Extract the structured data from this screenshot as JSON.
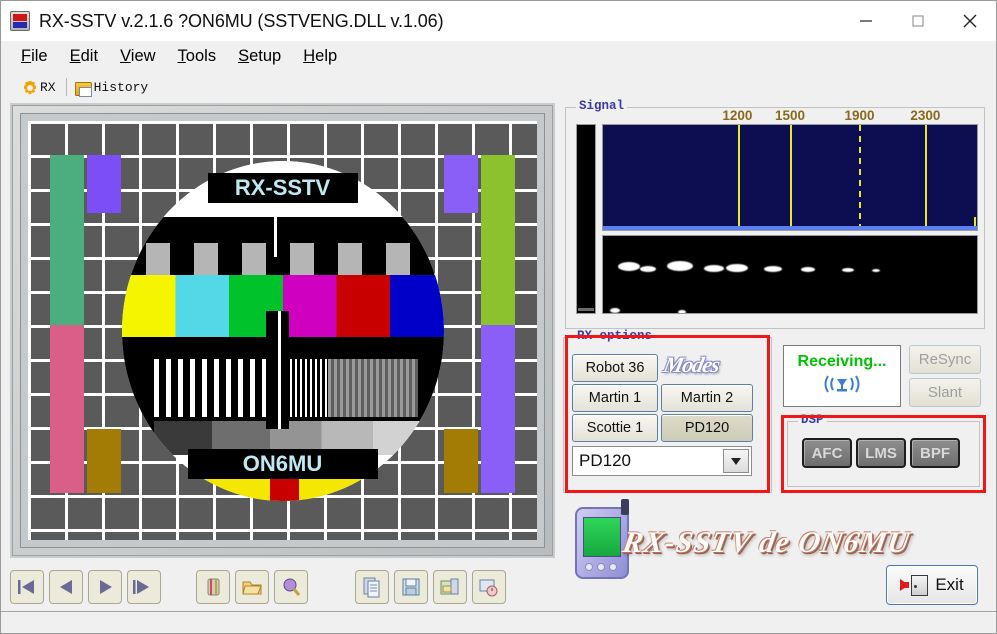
{
  "window": {
    "title": "RX-SSTV v.2.1.6 ?ON6MU (SSTVENG.DLL v.1.06)",
    "icon": "app-icon",
    "minimize": "—",
    "maximize": "□",
    "close": "✕"
  },
  "menu": {
    "items": [
      {
        "label": "File",
        "accel": "F"
      },
      {
        "label": "Edit",
        "accel": "E"
      },
      {
        "label": "View",
        "accel": "V"
      },
      {
        "label": "Tools",
        "accel": "T"
      },
      {
        "label": "Setup",
        "accel": "S"
      },
      {
        "label": "Help",
        "accel": "H"
      }
    ]
  },
  "tabs": {
    "items": [
      {
        "label": "RX",
        "icon": "gear-icon",
        "active": true
      },
      {
        "label": "History",
        "icon": "folder-icon",
        "active": false
      }
    ]
  },
  "image_panel": {
    "testcard": {
      "top_label": "RX-SSTV",
      "bottom_label": "ON6MU",
      "label_color": "#bfe9f0",
      "grid_color": "#5a5a5a",
      "color_bars": [
        "#f5f500",
        "#53d8e8",
        "#00c32b",
        "#cf00bf",
        "#c90000",
        "#0000c8"
      ],
      "side_bars_left": [
        "#4aae7e",
        "#d95f89",
        "#7c4ef5",
        "#a37c06"
      ],
      "side_bars_right": [
        "#8bc22e",
        "#8a5ff7",
        "#7c4ef5",
        "#a37c06"
      ],
      "grayscale_steps": [
        "#3a3a3a",
        "#6e6e6e",
        "#949494",
        "#b8b8b8",
        "#d2d2d2"
      ]
    }
  },
  "toolbar": {
    "nav": [
      {
        "name": "first-frame-button",
        "glyph": "|◀"
      },
      {
        "name": "previous-frame-button",
        "glyph": "◀"
      },
      {
        "name": "play-button",
        "glyph": "▶"
      },
      {
        "name": "last-frame-button",
        "glyph": "▶|"
      }
    ],
    "tools": [
      {
        "name": "delete-button",
        "icon": "trash-icon"
      },
      {
        "name": "open-button",
        "icon": "open-folder-icon"
      },
      {
        "name": "zoom-button",
        "icon": "magnifier-icon"
      }
    ],
    "file_tools": [
      {
        "name": "copy-button",
        "icon": "copy-icon"
      },
      {
        "name": "save-button",
        "icon": "floppy-disk-icon"
      },
      {
        "name": "save-as-button",
        "icon": "save-as-icon"
      },
      {
        "name": "capture-button",
        "icon": "camera-clock-icon"
      }
    ]
  },
  "signal": {
    "group_title": "Signal",
    "frequency_labels": [
      "1200",
      "1500",
      "1900",
      "2300"
    ],
    "markers": [
      {
        "freq": 1200,
        "style": "solid",
        "color": "#e8e82a"
      },
      {
        "freq": 1500,
        "style": "solid",
        "color": "#e8e82a"
      },
      {
        "freq": 1900,
        "style": "dashed",
        "color": "#e8e82a"
      },
      {
        "freq": 2300,
        "style": "solid",
        "color": "#e8e82a"
      }
    ],
    "spectrum_bg": "#0d0d52",
    "waterfall_bg": "#000000",
    "vu_label": "vu-meter"
  },
  "rx_options": {
    "group_title": "RX options",
    "highlight_color": "#f21616",
    "logo": "Modes",
    "buttons": [
      {
        "label": "Robot 36",
        "pressed": false
      },
      {
        "label": "Martin 1",
        "pressed": false
      },
      {
        "label": "Martin 2",
        "pressed": false
      },
      {
        "label": "Scottie 1",
        "pressed": false
      },
      {
        "label": "PD120",
        "pressed": true
      }
    ],
    "mode_select": {
      "value": "PD120",
      "options": [
        "Robot 36",
        "Martin 1",
        "Martin 2",
        "Scottie 1",
        "PD120"
      ]
    }
  },
  "status": {
    "receiving_text": "Receiving...",
    "receiving_color": "#00c400",
    "icon": "antenna-icon",
    "resync_label": "ReSync",
    "slant_label": "Slant"
  },
  "dsp": {
    "group_title": "DSP",
    "highlight_color": "#f21616",
    "buttons": [
      "AFC",
      "LMS",
      "BPF"
    ]
  },
  "brand": {
    "text": "RX-SSTV de ON6MU",
    "icon": "pda-icon"
  },
  "exit": {
    "label": "Exit",
    "icon": "exit-door-icon"
  }
}
